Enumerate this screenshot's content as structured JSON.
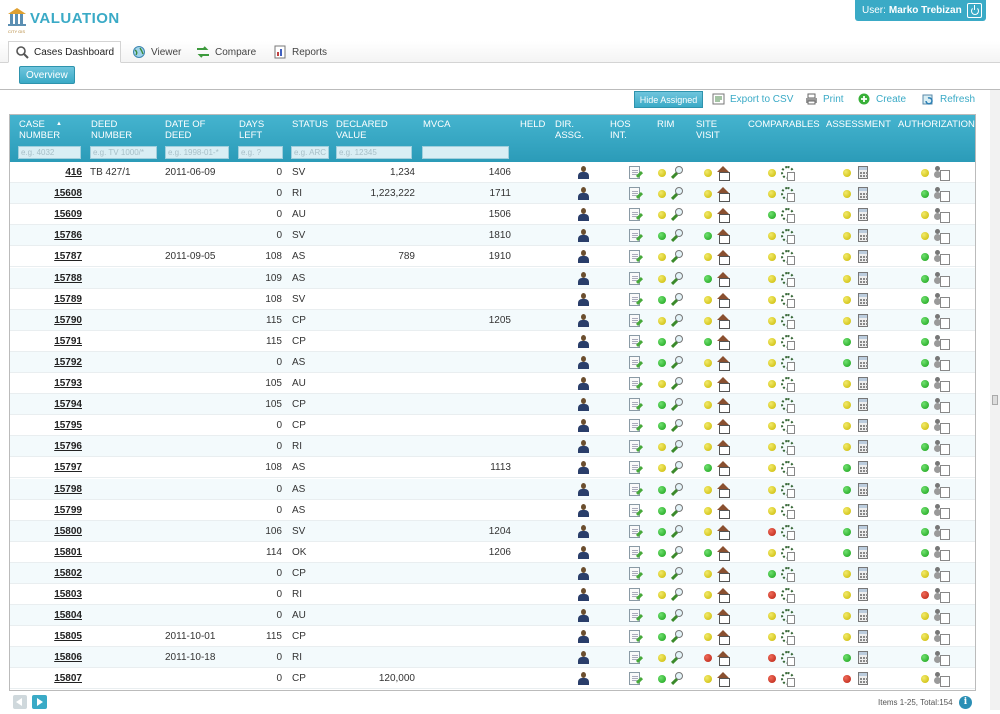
{
  "app": {
    "title": "VALUATION",
    "logo_sub": "CITY GIS"
  },
  "user": {
    "prefix": "User:",
    "name": "Marko Trebizan"
  },
  "tabs": [
    {
      "label": "Cases Dashboard",
      "icon": "search-icon"
    },
    {
      "label": "Viewer",
      "icon": "globe-icon"
    },
    {
      "label": "Compare",
      "icon": "compare-arrows-icon"
    },
    {
      "label": "Reports",
      "icon": "report-icon"
    }
  ],
  "subtab": {
    "overview": "Overview"
  },
  "toolbar": {
    "hide_assigned": "Hide Assigned",
    "export": "Export to CSV",
    "print": "Print",
    "create": "Create",
    "refresh": "Refresh"
  },
  "columns": {
    "case_number": "CASE NUMBER",
    "deed_number": "DEED NUMBER",
    "date_of_deed": "DATE OF DEED",
    "days_left": "DAYS LEFT",
    "status": "STATUS",
    "declared_value": "DECLARED VALUE",
    "mvca": "MVCA",
    "held": "HELD",
    "dir_assg": "DIR. ASSG.",
    "hos_int": "HOS INT.",
    "rim": "RIM",
    "site_visit": "SITE VISIT",
    "comparables": "COMPARABLES",
    "assessment": "ASSESSMENT",
    "authorization": "AUTHORIZATION"
  },
  "filters": {
    "case_number": "e.g. 4032",
    "deed_number": "e.g. TV 1000/*",
    "date_of_deed": "e.g. 1998-01-*",
    "days_left": "e.g. ?",
    "status": "e.g. ARC",
    "declared_value": "e.g. 12345",
    "mvca": ""
  },
  "colors": {
    "accent": "#3aaac6",
    "yellow": "#d8c800",
    "green": "#22b022",
    "red": "#c83020"
  },
  "rows": [
    {
      "case": "416",
      "deed": "TB 427/1",
      "date": "2011-06-09",
      "days": "0",
      "status": "SV",
      "declared": "1,234",
      "mvca": "1406",
      "rim": "yellow",
      "site": "yellow",
      "comp": "yellow",
      "assess": "yellow",
      "auth": "yellow"
    },
    {
      "case": "15608",
      "deed": "",
      "date": "",
      "days": "0",
      "status": "RI",
      "declared": "1,223,222",
      "mvca": "1711",
      "rim": "yellow",
      "site": "yellow",
      "comp": "yellow",
      "assess": "yellow",
      "auth": "green"
    },
    {
      "case": "15609",
      "deed": "",
      "date": "",
      "days": "0",
      "status": "AU",
      "declared": "",
      "mvca": "1506",
      "rim": "yellow",
      "site": "yellow",
      "comp": "green",
      "assess": "yellow",
      "auth": "yellow"
    },
    {
      "case": "15786",
      "deed": "",
      "date": "",
      "days": "0",
      "status": "SV",
      "declared": "",
      "mvca": "1810",
      "rim": "green",
      "site": "green",
      "comp": "yellow",
      "assess": "yellow",
      "auth": "yellow"
    },
    {
      "case": "15787",
      "deed": "",
      "date": "2011-09-05",
      "days": "108",
      "status": "AS",
      "declared": "789",
      "mvca": "1910",
      "rim": "yellow",
      "site": "yellow",
      "comp": "yellow",
      "assess": "yellow",
      "auth": "green"
    },
    {
      "case": "15788",
      "deed": "",
      "date": "",
      "days": "109",
      "status": "AS",
      "declared": "",
      "mvca": "",
      "rim": "yellow",
      "site": "green",
      "comp": "yellow",
      "assess": "yellow",
      "auth": "green"
    },
    {
      "case": "15789",
      "deed": "",
      "date": "",
      "days": "108",
      "status": "SV",
      "declared": "",
      "mvca": "",
      "rim": "green",
      "site": "yellow",
      "comp": "yellow",
      "assess": "yellow",
      "auth": "green"
    },
    {
      "case": "15790",
      "deed": "",
      "date": "",
      "days": "115",
      "status": "CP",
      "declared": "",
      "mvca": "1205",
      "rim": "yellow",
      "site": "yellow",
      "comp": "yellow",
      "assess": "yellow",
      "auth": "green"
    },
    {
      "case": "15791",
      "deed": "",
      "date": "",
      "days": "115",
      "status": "CP",
      "declared": "",
      "mvca": "",
      "rim": "green",
      "site": "green",
      "comp": "yellow",
      "assess": "green",
      "auth": "green"
    },
    {
      "case": "15792",
      "deed": "",
      "date": "",
      "days": "0",
      "status": "AS",
      "declared": "",
      "mvca": "",
      "rim": "green",
      "site": "yellow",
      "comp": "yellow",
      "assess": "green",
      "auth": "green"
    },
    {
      "case": "15793",
      "deed": "",
      "date": "",
      "days": "105",
      "status": "AU",
      "declared": "",
      "mvca": "",
      "rim": "yellow",
      "site": "yellow",
      "comp": "yellow",
      "assess": "yellow",
      "auth": "green"
    },
    {
      "case": "15794",
      "deed": "",
      "date": "",
      "days": "105",
      "status": "CP",
      "declared": "",
      "mvca": "",
      "rim": "green",
      "site": "yellow",
      "comp": "yellow",
      "assess": "yellow",
      "auth": "green"
    },
    {
      "case": "15795",
      "deed": "",
      "date": "",
      "days": "0",
      "status": "CP",
      "declared": "",
      "mvca": "",
      "rim": "green",
      "site": "yellow",
      "comp": "yellow",
      "assess": "yellow",
      "auth": "yellow"
    },
    {
      "case": "15796",
      "deed": "",
      "date": "",
      "days": "0",
      "status": "RI",
      "declared": "",
      "mvca": "",
      "rim": "yellow",
      "site": "yellow",
      "comp": "yellow",
      "assess": "yellow",
      "auth": "green"
    },
    {
      "case": "15797",
      "deed": "",
      "date": "",
      "days": "108",
      "status": "AS",
      "declared": "",
      "mvca": "1113",
      "rim": "yellow",
      "site": "green",
      "comp": "yellow",
      "assess": "green",
      "auth": "green"
    },
    {
      "case": "15798",
      "deed": "",
      "date": "",
      "days": "0",
      "status": "AS",
      "declared": "",
      "mvca": "",
      "rim": "green",
      "site": "yellow",
      "comp": "yellow",
      "assess": "green",
      "auth": "green"
    },
    {
      "case": "15799",
      "deed": "",
      "date": "",
      "days": "0",
      "status": "AS",
      "declared": "",
      "mvca": "",
      "rim": "green",
      "site": "yellow",
      "comp": "yellow",
      "assess": "yellow",
      "auth": "green"
    },
    {
      "case": "15800",
      "deed": "",
      "date": "",
      "days": "106",
      "status": "SV",
      "declared": "",
      "mvca": "1204",
      "rim": "green",
      "site": "yellow",
      "comp": "red",
      "assess": "green",
      "auth": "green"
    },
    {
      "case": "15801",
      "deed": "",
      "date": "",
      "days": "114",
      "status": "OK",
      "declared": "",
      "mvca": "1206",
      "rim": "green",
      "site": "green",
      "comp": "yellow",
      "assess": "green",
      "auth": "green"
    },
    {
      "case": "15802",
      "deed": "",
      "date": "",
      "days": "0",
      "status": "CP",
      "declared": "",
      "mvca": "",
      "rim": "yellow",
      "site": "yellow",
      "comp": "green",
      "assess": "yellow",
      "auth": "yellow"
    },
    {
      "case": "15803",
      "deed": "",
      "date": "",
      "days": "0",
      "status": "RI",
      "declared": "",
      "mvca": "",
      "rim": "yellow",
      "site": "yellow",
      "comp": "red",
      "assess": "yellow",
      "auth": "red"
    },
    {
      "case": "15804",
      "deed": "",
      "date": "",
      "days": "0",
      "status": "AU",
      "declared": "",
      "mvca": "",
      "rim": "green",
      "site": "yellow",
      "comp": "yellow",
      "assess": "yellow",
      "auth": "yellow"
    },
    {
      "case": "15805",
      "deed": "",
      "date": "2011-10-01",
      "days": "115",
      "status": "CP",
      "declared": "",
      "mvca": "",
      "rim": "green",
      "site": "yellow",
      "comp": "yellow",
      "assess": "yellow",
      "auth": "yellow"
    },
    {
      "case": "15806",
      "deed": "",
      "date": "2011-10-18",
      "days": "0",
      "status": "RI",
      "declared": "",
      "mvca": "",
      "rim": "yellow",
      "site": "red",
      "comp": "red",
      "assess": "green",
      "auth": "green"
    },
    {
      "case": "15807",
      "deed": "",
      "date": "",
      "days": "0",
      "status": "CP",
      "declared": "120,000",
      "mvca": "",
      "rim": "green",
      "site": "yellow",
      "comp": "red",
      "assess": "red",
      "auth": "yellow"
    }
  ],
  "pager": {
    "info": "Items 1-25, Total:154"
  }
}
